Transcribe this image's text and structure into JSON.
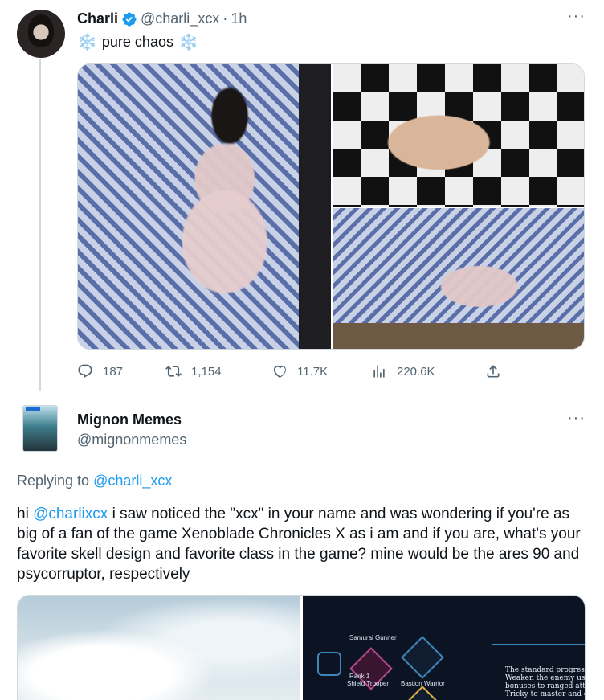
{
  "tweet1": {
    "author_name": "Charli",
    "handle": "@charli_xcx",
    "separator": "·",
    "time": "1h",
    "text": "pure chaos",
    "emoji_left": "❄️",
    "emoji_right": "❄️",
    "more": "···",
    "stats": {
      "replies": "187",
      "retweets": "1,154",
      "likes": "11.7K",
      "views": "220.6K"
    }
  },
  "tweet2": {
    "author_name": "Mignon Memes",
    "handle": "@mignonmemes",
    "more": "···",
    "replying_prefix": "Replying to",
    "replying_to": "@charli_xcx",
    "text_prefix": "hi",
    "mention": "@charlixcx",
    "text_body": "i saw noticed the \"xcx\" in your name and was wondering if you're as big of a fan of the game Xenoblade Chronicles X as i am and if you are, what's your favorite skell design and favorite class in the game? mine would be the ares 90 and psycorruptor, respectively",
    "media_labels": {
      "top": "Samurai Gunner",
      "left": "Shield Trooper",
      "mid": "Bastion Warrior",
      "rank": "Rank 1",
      "desc": "The standard progressio Weaken the enemy usi bonuses to ranged atta Tricky to master and c"
    }
  },
  "colors": {
    "verified": "#1d9bf0",
    "link": "#1d9bf0",
    "secondary_text": "#536471"
  }
}
